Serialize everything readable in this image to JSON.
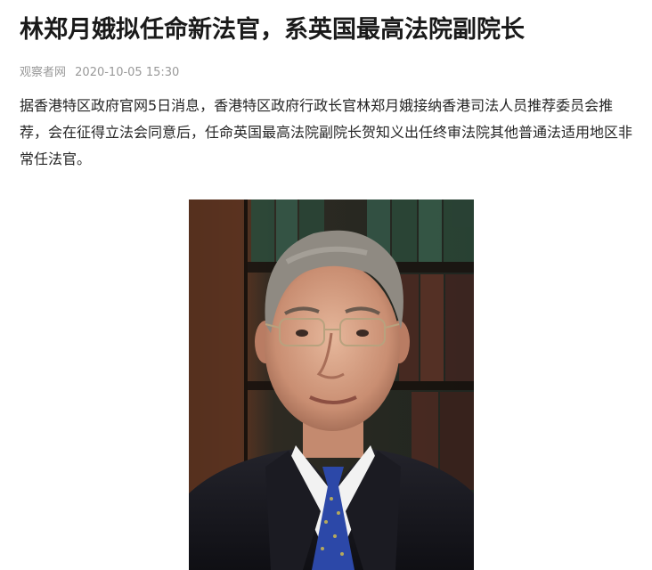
{
  "article": {
    "title": "林郑月娥拟任命新法官，系英国最高法院副院长",
    "source": "观察者网",
    "datetime": "2020-10-05 15:30",
    "paragraph": "据香港特区政府官网5日消息，香港特区政府行政长官林郑月娥接纳香港司法人员推荐委员会推荐，会在征得立法会同意后，任命英国最高法院副院长贺知义出任终审法院其他普通法适用地区非常任法官。"
  }
}
